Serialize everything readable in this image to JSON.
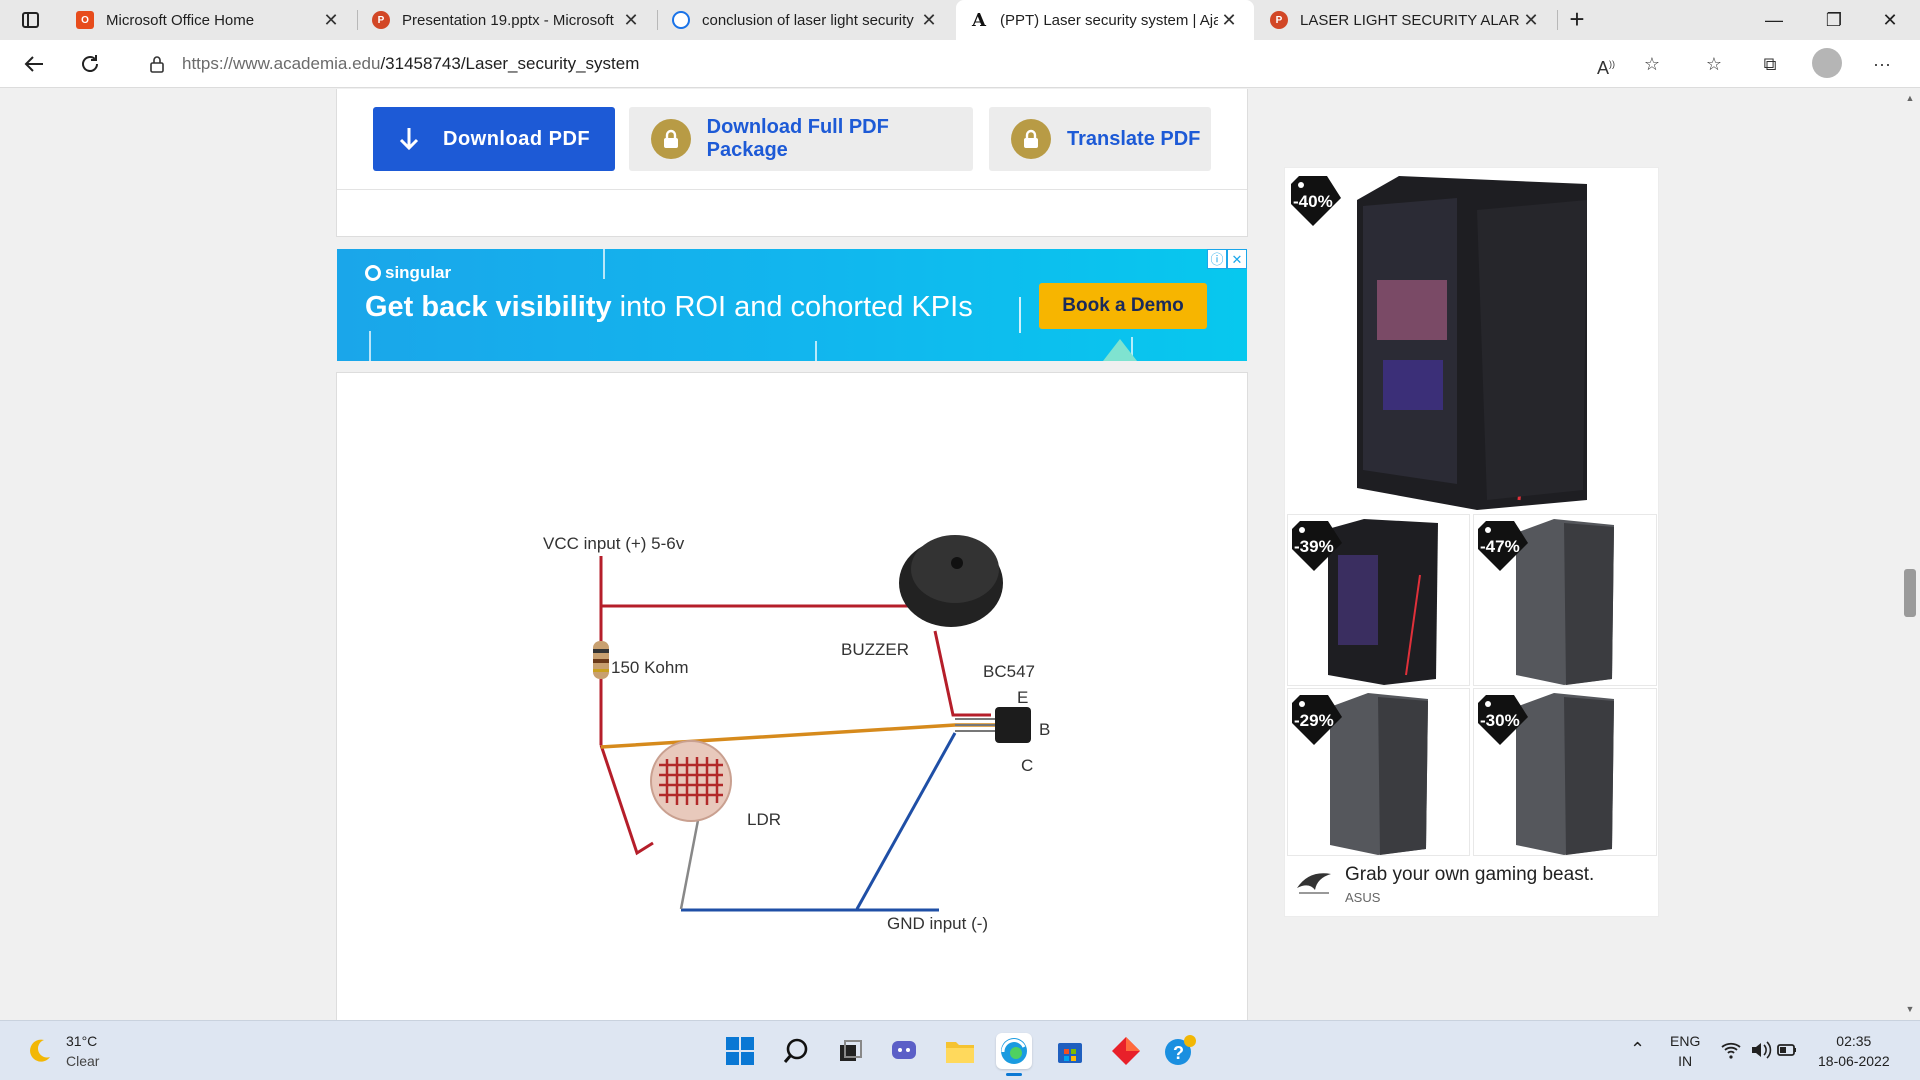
{
  "browser": {
    "tabs": [
      {
        "title": "Microsoft Office Home",
        "active": false
      },
      {
        "title": "Presentation 19.pptx - Microsoft",
        "active": false
      },
      {
        "title": "conclusion of laser light security",
        "active": false
      },
      {
        "title": "(PPT) Laser security system | Ajay",
        "active": true
      },
      {
        "title": "LASER LIGHT SECURITY ALARM.p",
        "active": false
      }
    ],
    "url_host": "https://www.academia.edu",
    "url_path": "/31458743/Laser_security_system"
  },
  "toolbar": {
    "download_pdf": "Download PDF",
    "download_package": "Download Full PDF Package",
    "translate_pdf": "Translate PDF"
  },
  "banner_ad": {
    "brand": "singular",
    "headline_bold": "Get back visibility",
    "headline_rest": " into ROI and cohorted KPIs",
    "cta": "Book a Demo"
  },
  "diagram": {
    "vcc_label": "VCC input (+) 5-6v",
    "buzzer_label": "BUZZER",
    "transistor_label": "BC547",
    "pin_e": "E",
    "pin_b": "B",
    "pin_c": "C",
    "resistor_label": "150 Kohm",
    "ldr_label": "LDR",
    "gnd_label": "GND input (-)"
  },
  "side_ad": {
    "discounts": [
      "-40%",
      "-39%",
      "-47%",
      "-29%",
      "-30%"
    ],
    "tagline": "Grab your own gaming beast.",
    "advertiser": "ASUS"
  },
  "taskbar": {
    "temperature": "31°C",
    "condition": "Clear",
    "lang_top": "ENG",
    "lang_bottom": "IN",
    "time": "02:35",
    "date": "18-06-2022"
  },
  "colors": {
    "accent": "#1d5ad6",
    "banner": "#1aa6ea",
    "cta": "#f7b500"
  }
}
